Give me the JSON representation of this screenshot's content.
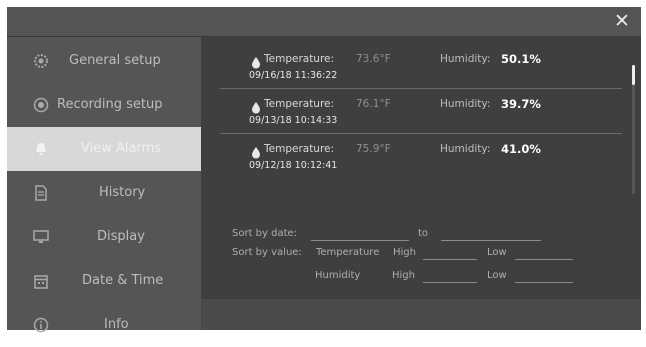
{
  "window": {
    "close_glyph": "✕"
  },
  "sidebar": {
    "items": [
      {
        "label": "General setup",
        "icon": "gear-icon"
      },
      {
        "label": "Recording setup",
        "icon": "recording-icon"
      },
      {
        "label": "View Alarms",
        "icon": "alarm-icon",
        "active": true
      },
      {
        "label": "History",
        "icon": "document-icon"
      },
      {
        "label": "Display",
        "icon": "monitor-icon"
      },
      {
        "label": "Date & Time",
        "icon": "calendar-icon"
      },
      {
        "label": "Info",
        "icon": "info-icon"
      }
    ]
  },
  "alarms": [
    {
      "temp_label": "Temperature:",
      "temp_value": "73.6°F",
      "hum_label": "Humidity:",
      "hum_value": "50.1%",
      "datetime": "09/16/18 11:36:22"
    },
    {
      "temp_label": "Temperature:",
      "temp_value": "76.1°F",
      "hum_label": "Humidity:",
      "hum_value": "39.7%",
      "datetime": "09/13/18 10:14:33"
    },
    {
      "temp_label": "Temperature:",
      "temp_value": "75.9°F",
      "hum_label": "Humidity:",
      "hum_value": "41.0%",
      "datetime": "09/12/18 10:12:41"
    }
  ],
  "filters": {
    "sort_by_date": "Sort by date:",
    "to": "to",
    "sort_by_value": "Sort by value:",
    "temperature": "Temperature",
    "humidity": "Humidity",
    "high": "High",
    "low": "Low",
    "date_from_value": "",
    "date_to_value": "",
    "temp_high_value": "",
    "temp_low_value": "",
    "hum_high_value": "",
    "hum_low_value": ""
  },
  "colors": {
    "active_tab": "#d8d8d8",
    "panel": "#3f3f3f",
    "sidebar": "#555555"
  }
}
